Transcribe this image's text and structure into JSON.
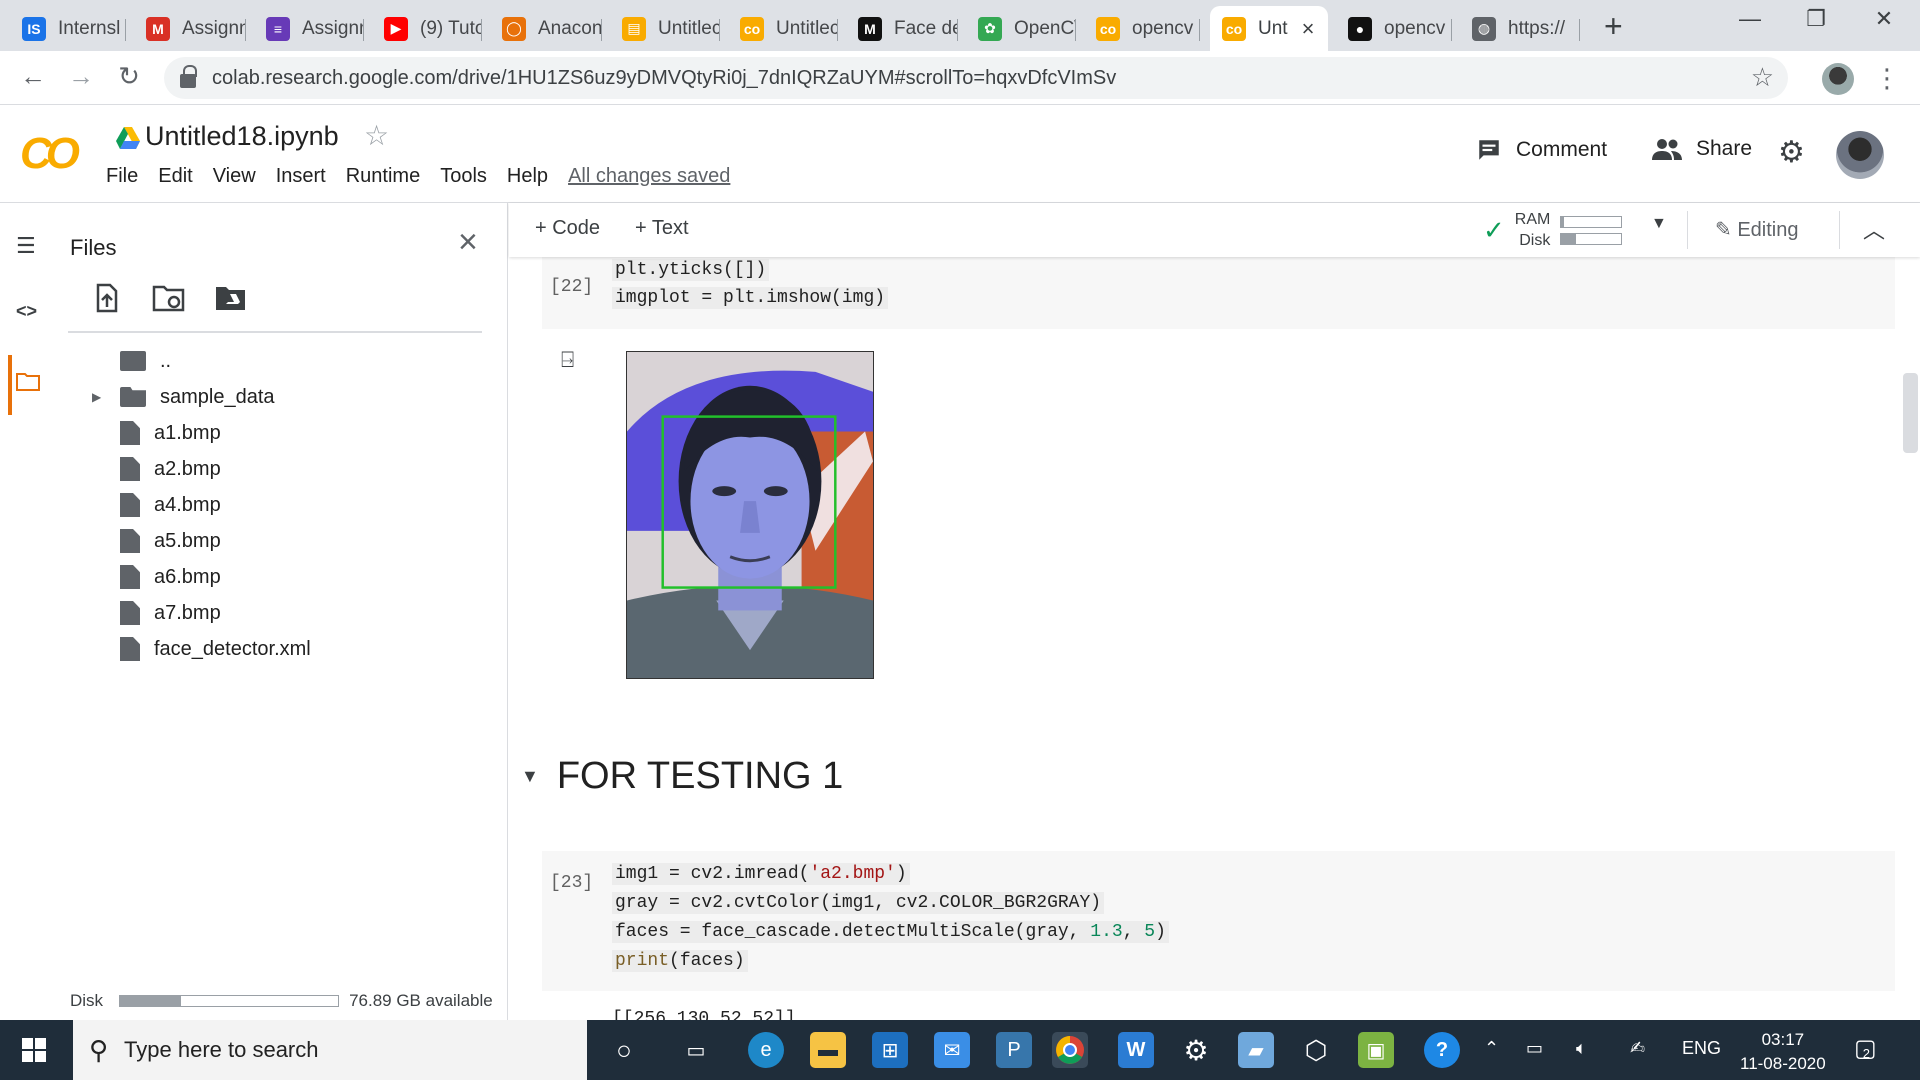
{
  "browser": {
    "tabs": [
      {
        "label": "Internsl",
        "favicon": "IS",
        "color": "#1a73e8"
      },
      {
        "label": "Assignn",
        "favicon": "M",
        "color": "#d93025"
      },
      {
        "label": "Assignn",
        "favicon": "≡",
        "color": "#673ab7"
      },
      {
        "label": "(9) Tuto",
        "favicon": "▶",
        "color": "#ff0000"
      },
      {
        "label": "Anacon",
        "favicon": "◯",
        "color": "#e8710a"
      },
      {
        "label": "Untitlec",
        "favicon": "▤",
        "color": "#f9ab00"
      },
      {
        "label": "Untitlec",
        "favicon": "co",
        "color": "#f9ab00"
      },
      {
        "label": "Face de",
        "favicon": "M",
        "color": "#111111"
      },
      {
        "label": "OpenC\\",
        "favicon": "✿",
        "color": "#34a853"
      },
      {
        "label": "opencv",
        "favicon": "co",
        "color": "#f9ab00"
      },
      {
        "label": "Unt",
        "favicon": "co",
        "color": "#f9ab00",
        "active": true
      },
      {
        "label": "opencv",
        "favicon": "●",
        "color": "#111111"
      },
      {
        "label": "https://",
        "favicon": "◍",
        "color": "#5f6368"
      }
    ],
    "new_tab_icon": "+",
    "window_controls": {
      "minimize": "—",
      "restore": "❐",
      "close": "✕"
    },
    "url": "colab.research.google.com/drive/1HU1ZS6uz9yDMVQtyRi0j_7dnIQRZaUYM#scrollTo=hqxvDfcVImSv",
    "icons": [
      "back-icon",
      "forward-icon",
      "reload-icon",
      "lock-icon",
      "bookmark-star-icon",
      "kebab-menu-icon"
    ]
  },
  "colab": {
    "logo": "CO",
    "notebook_title": "Untitled18.ipynb",
    "menu": [
      "File",
      "Edit",
      "View",
      "Insert",
      "Runtime",
      "Tools",
      "Help"
    ],
    "save_status": "All changes saved",
    "comment_label": "Comment",
    "share_label": "Share",
    "toolbar": {
      "add_code": "+ Code",
      "add_text": "+ Text",
      "ram_label": "RAM",
      "disk_label": "Disk",
      "ram_fraction": 0.04,
      "disk_fraction": 0.25,
      "editing_label": "Editing"
    }
  },
  "files": {
    "title": "Files",
    "items": [
      {
        "name": "..",
        "kind": "parent"
      },
      {
        "name": "sample_data",
        "kind": "folder"
      },
      {
        "name": "a1.bmp",
        "kind": "file"
      },
      {
        "name": "a2.bmp",
        "kind": "file"
      },
      {
        "name": "a4.bmp",
        "kind": "file"
      },
      {
        "name": "a5.bmp",
        "kind": "file"
      },
      {
        "name": "a6.bmp",
        "kind": "file"
      },
      {
        "name": "a7.bmp",
        "kind": "file"
      },
      {
        "name": "face_detector.xml",
        "kind": "file"
      }
    ],
    "disk_label": "Disk",
    "disk_fraction": 0.28,
    "disk_available": "76.89 GB available"
  },
  "notebook": {
    "cell22": {
      "count": "[22]",
      "lines": [
        "plt.yticks([])",
        "imgplot = plt.imshow(img)"
      ]
    },
    "section_title": "FOR TESTING 1",
    "cell23": {
      "count": "[23]",
      "line1_a": "img1 = cv2.imread(",
      "line1_str": "'a2.bmp'",
      "line1_b": ")",
      "line2": "gray = cv2.cvtColor(img1, cv2.COLOR_BGR2GRAY)",
      "line3_a": "faces = face_cascade.detectMultiScale(gray, ",
      "line3_n1": "1.3",
      "line3_c": ", ",
      "line3_n2": "5",
      "line3_b": ")",
      "line4_kw": "print",
      "line4_b": "(faces)"
    },
    "output_peek": "[[256 130  52  52]]"
  },
  "taskbar": {
    "search_placeholder": "Type here to search",
    "language": "ENG",
    "time": "03:17",
    "date": "11-08-2020",
    "notification_count": "2"
  }
}
